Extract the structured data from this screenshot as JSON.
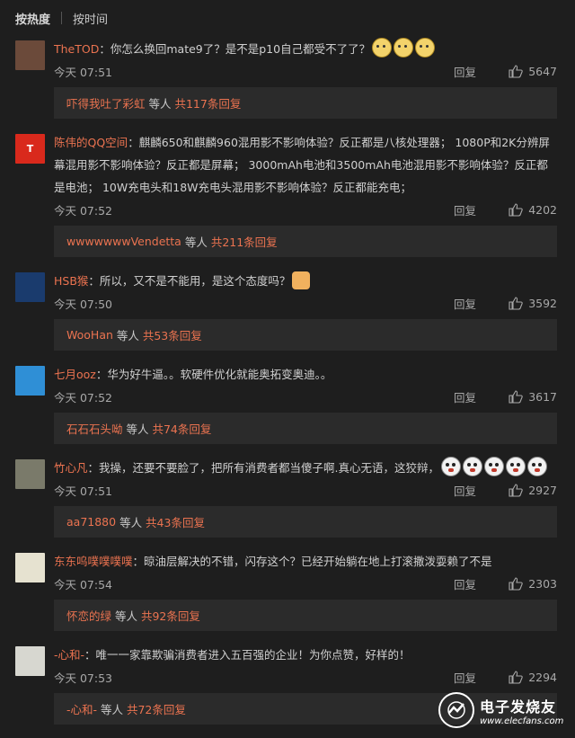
{
  "sort": {
    "hot": "按热度",
    "time": "按时间"
  },
  "comments": [
    {
      "user": "TheTOD",
      "text": "：你怎么换回mate9了？是不是p10自己都受不了了？",
      "time": "今天 07:51",
      "reply_label": "回复",
      "likes": "5647",
      "emoji": [
        "doge",
        "doge",
        "doge"
      ],
      "replies": {
        "who": "吓得我吐了彩虹",
        "mid": " 等人 ",
        "count": "共117条回复"
      }
    },
    {
      "user": "陈伟的QQ空间",
      "text": "：麒麟650和麒麟960混用影不影响体验？反正都是八核处理器； 1080P和2K分辨屏幕混用影不影响体验？反正都是屏幕； 3000mAh电池和3500mAh电池混用影不影响体验？反正都是电池； 10W充电头和18W充电头混用影不影响体验？反正都能充电；",
      "time": "今天 07:52",
      "reply_label": "回复",
      "likes": "4202",
      "replies": {
        "who": "wwwwwwwVendetta",
        "mid": " 等人 ",
        "count": "共211条回复"
      }
    },
    {
      "user": "HSB猴",
      "text": "：所以，又不是不能用，是这个态度吗？",
      "time": "今天 07:50",
      "reply_label": "回复",
      "likes": "3592",
      "emoji": [
        "thumbs"
      ],
      "replies": {
        "who": "WooHan",
        "mid": " 等人 ",
        "count": "共53条回复"
      }
    },
    {
      "user": "七月ooz",
      "text": "：华为好牛逼。。软硬件优化就能奥拓变奥迪。。",
      "time": "今天 07:52",
      "reply_label": "回复",
      "likes": "3617",
      "replies": {
        "who": "石石石头呦",
        "mid": " 等人 ",
        "count": "共74条回复"
      }
    },
    {
      "user": "竹心凡",
      "text": "：我操，还要不要脸了，把所有消费者都当傻子啊.真心无语，这狡辩，",
      "time": "今天 07:51",
      "reply_label": "回复",
      "likes": "2927",
      "emoji": [
        "ghost",
        "ghost",
        "ghost",
        "ghost",
        "ghost"
      ],
      "replies": {
        "who": "aa71880",
        "mid": " 等人 ",
        "count": "共43条回复"
      }
    },
    {
      "user": "东东呜噗噗噗噗",
      "text": "：晾油层解决的不错，闪存这个？已经开始躺在地上打滚撒泼耍赖了不是",
      "time": "今天 07:54",
      "reply_label": "回复",
      "likes": "2303",
      "replies": {
        "who": "怀恋的绿",
        "mid": " 等人 ",
        "count": "共92条回复"
      }
    },
    {
      "user": "-心和-",
      "text": "：唯一一家靠欺骗消费者进入五百强的企业！为你点赞，好样的！",
      "time": "今天 07:53",
      "reply_label": "回复",
      "likes": "2294",
      "replies": {
        "who": "-心和-",
        "mid": " 等人 ",
        "count": "共72条回复"
      }
    }
  ],
  "avatars": [
    {
      "bg": "#6b4a3a",
      "glyph": ""
    },
    {
      "bg": "#d9291c",
      "glyph": "T"
    },
    {
      "bg": "#1a3b6d",
      "glyph": ""
    },
    {
      "bg": "#2f8fd6",
      "glyph": ""
    },
    {
      "bg": "#7a7a6a",
      "glyph": ""
    },
    {
      "bg": "#e6e2d0",
      "glyph": ""
    },
    {
      "bg": "#d7d7d0",
      "glyph": ""
    }
  ],
  "watermark": {
    "cn": "电子发烧友",
    "url": "www.elecfans.com"
  }
}
